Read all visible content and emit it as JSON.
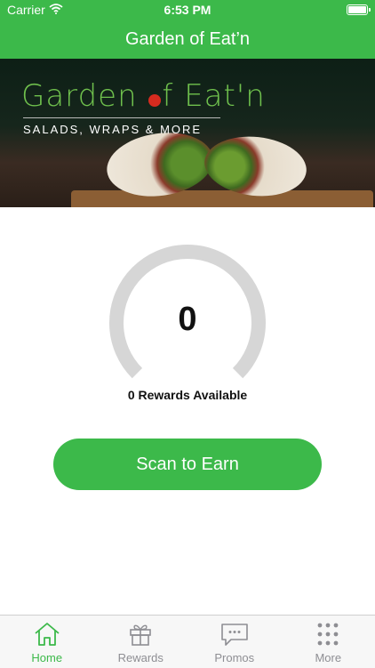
{
  "status_bar": {
    "carrier": "Carrier",
    "time": "6:53 PM",
    "battery_level": 1.0
  },
  "navbar": {
    "title": "Garden of Eat’n"
  },
  "hero": {
    "brand_left": "Garden ",
    "brand_right": "f Eat'n",
    "tagline": "SALADS, WRAPS & MORE"
  },
  "rewards": {
    "points": "0",
    "available_text": "0 Rewards Available"
  },
  "actions": {
    "scan_label": "Scan to Earn"
  },
  "tabs": [
    {
      "label": "Home",
      "icon": "home-icon",
      "active": true
    },
    {
      "label": "Rewards",
      "icon": "gift-icon",
      "active": false
    },
    {
      "label": "Promos",
      "icon": "chat-icon",
      "active": false
    },
    {
      "label": "More",
      "icon": "dots-grid-icon",
      "active": false
    }
  ],
  "colors": {
    "brand_green": "#3cb94a",
    "gauge_track": "#d6d6d6",
    "inactive_tab": "#8e8e93"
  }
}
